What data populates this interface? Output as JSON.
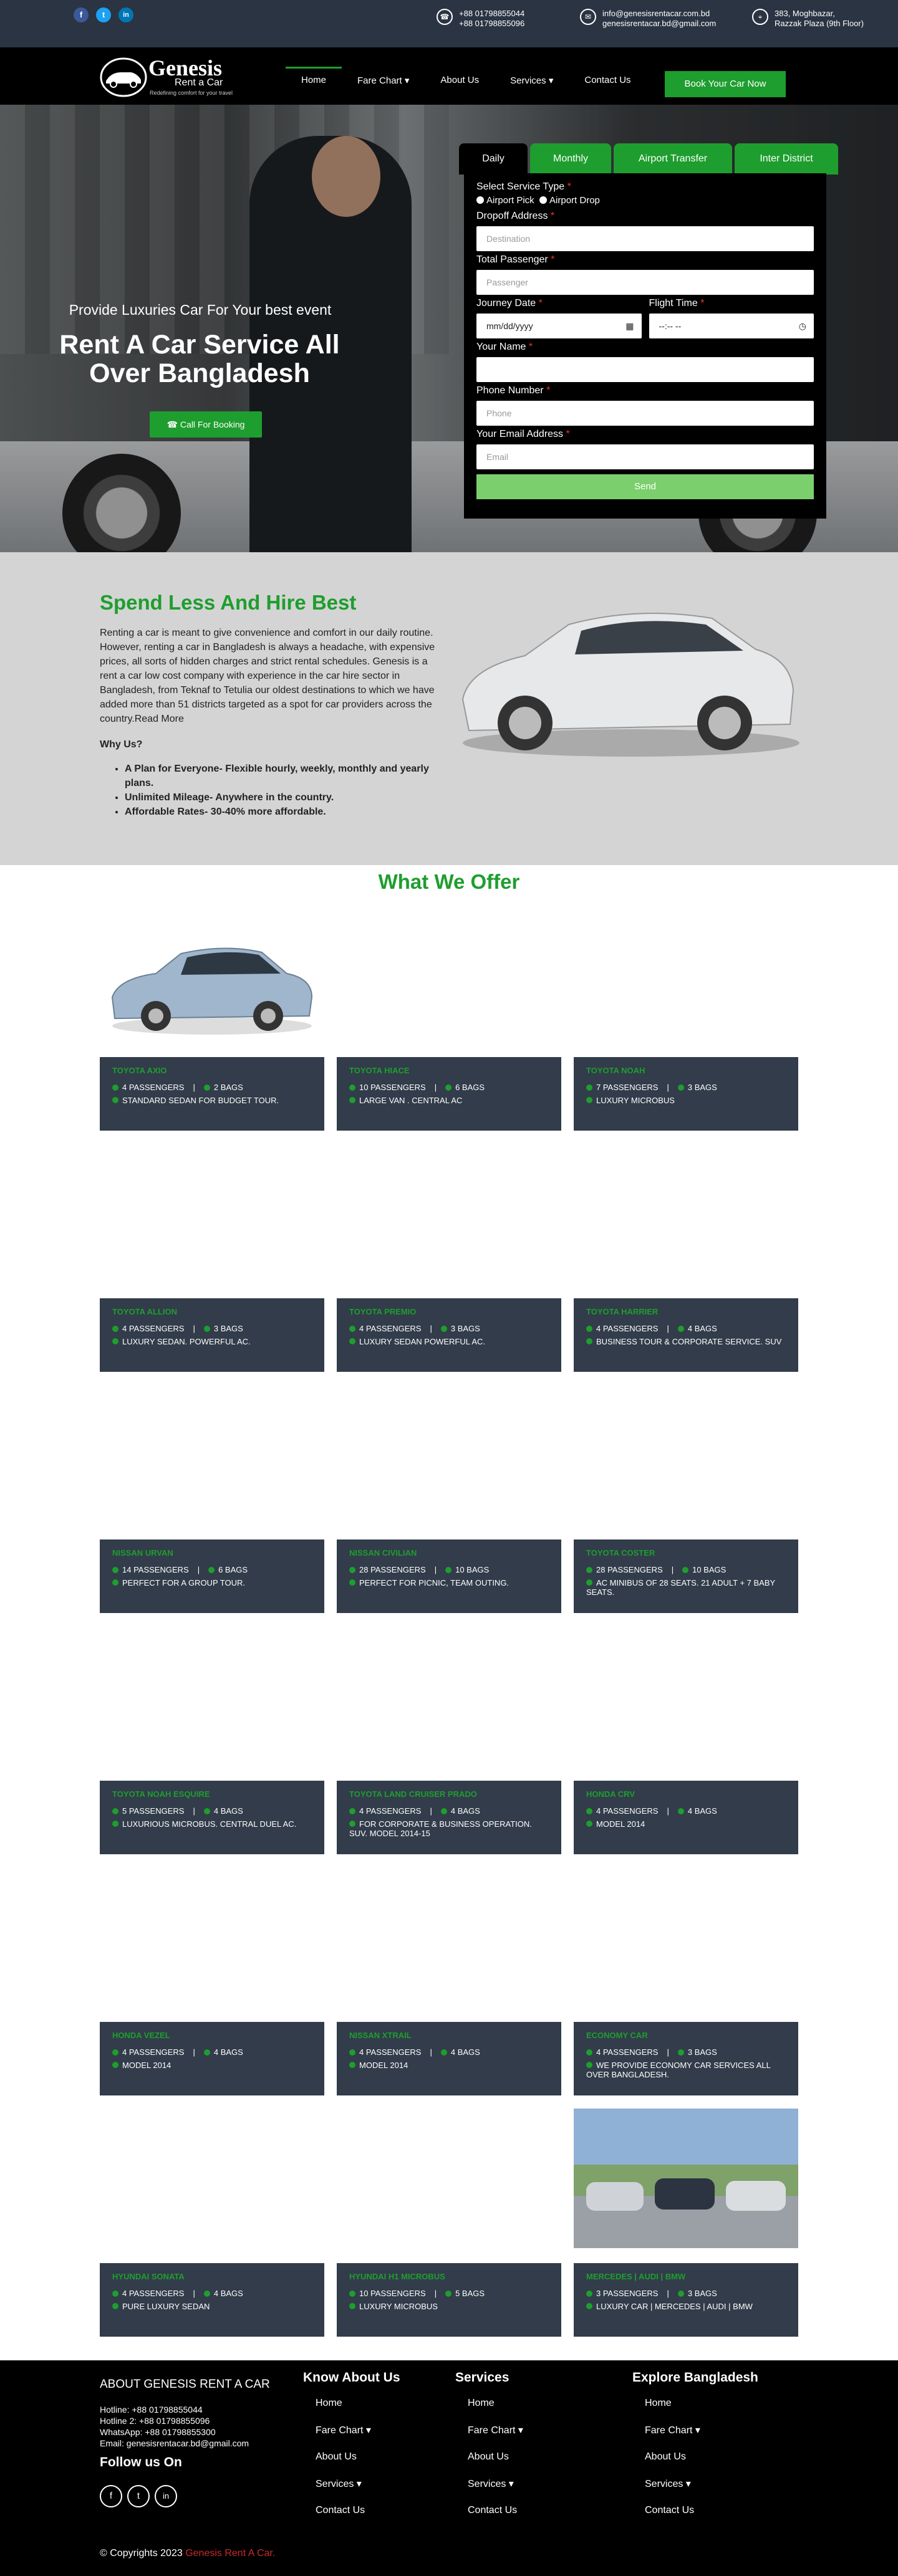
{
  "topbar": {
    "social": [
      "f",
      "t",
      "in"
    ],
    "phone1": "+88 01798855044",
    "phone2": "+88 01798855096",
    "email1": "info@genesisrentacar.com.bd",
    "email2": "genesisrentacar.bd@gmail.com",
    "address1": "383, Moghbazar,",
    "address2": "Razzak Plaza (9th Floor)"
  },
  "logo": {
    "name": "Genesis",
    "sub": "Rent a Car",
    "tagline": "Redefining comfort for your travel"
  },
  "nav": {
    "items": [
      "Home",
      "Fare Chart",
      "About Us",
      "Services",
      "Contact Us"
    ],
    "book": "Book Your Car Now"
  },
  "hero": {
    "tagline": "Provide Luxuries Car For Your best event",
    "title": "Rent A Car Service All Over Bangladesh",
    "call": "Call For Booking"
  },
  "tabs": [
    "Daily",
    "Monthly",
    "Airport Transfer",
    "Inter District"
  ],
  "form": {
    "service_type": "Select Service Type",
    "opt1": "Airport Pick",
    "opt2": "Airport Drop",
    "dropoff": "Dropoff Address",
    "dropoff_ph": "Destination",
    "passenger": "Total Passenger",
    "passenger_ph": "Passenger",
    "date": "Journey Date",
    "date_ph": "mm/dd/yyyy",
    "time": "Flight Time",
    "time_ph": "--:-- --",
    "name": "Your Name",
    "phone": "Phone Number",
    "phone_ph": "Phone",
    "email": "Your Email Address",
    "email_ph": "Email",
    "send": "Send"
  },
  "about": {
    "title": "Spend Less And Hire Best",
    "text": "Renting a car is meant to give convenience and comfort in our daily routine. However, renting a car in Bangladesh is always a headache, with expensive prices, all sorts of hidden charges and strict rental schedules. Genesis is a rent a car low cost company with experience in the car hire sector in Bangladesh, from Teknaf to Tetulia our oldest destinations to which we have added more than 51 districts targeted as a spot for car providers across the country.Read More",
    "why": "Why Us?",
    "points": [
      "A Plan for Everyone- Flexible hourly, weekly, monthly and yearly plans.",
      "Unlimited Mileage- Anywhere in the country.",
      "Affordable Rates- 30-40% more affordable."
    ]
  },
  "offer_title": "What We Offer",
  "cars": [
    {
      "name": "TOYOTA AXIO",
      "pass": "4 PASSENGERS",
      "bags": "2 BAGS",
      "desc": "STANDARD SEDAN FOR BUDGET TOUR."
    },
    {
      "name": "TOYOTA HIACE",
      "pass": "10 PASSENGERS",
      "bags": "6 BAGS",
      "desc": "LARGE VAN . CENTRAL AC"
    },
    {
      "name": "TOYOTA NOAH",
      "pass": "7 PASSENGERS",
      "bags": "3 BAGS",
      "desc": "LUXURY MICROBUS"
    },
    {
      "name": "TOYOTA ALLION",
      "pass": "4 PASSENGERS",
      "bags": "3 BAGS",
      "desc": "LUXURY SEDAN. POWERFUL AC."
    },
    {
      "name": "TOYOTA PREMIO",
      "pass": "4 PASSENGERS",
      "bags": "3 BAGS",
      "desc": "LUXURY SEDAN POWERFUL AC."
    },
    {
      "name": "TOYOTA HARRIER",
      "pass": "4 PASSENGERS",
      "bags": "4 BAGS",
      "desc": "BUSINESS TOUR & CORPORATE SERVICE. SUV"
    },
    {
      "name": "NISSAN URVAN",
      "pass": "14 PASSENGERS",
      "bags": "6 BAGS",
      "desc": "PERFECT FOR A GROUP TOUR."
    },
    {
      "name": "NISSAN CIVILIAN",
      "pass": "28 PASSENGERS",
      "bags": "10 BAGS",
      "desc": "PERFECT FOR PICNIC, TEAM OUTING."
    },
    {
      "name": "TOYOTA COSTER",
      "pass": "28 PASSENGERS",
      "bags": "10 BAGS",
      "desc": "AC MINIBUS OF 28 SEATS. 21 ADULT + 7 BABY SEATS."
    },
    {
      "name": "TOYOTA NOAH ESQUIRE",
      "pass": "5 PASSENGERS",
      "bags": "4 BAGS",
      "desc": "LUXURIOUS MICROBUS. CENTRAL DUEL AC."
    },
    {
      "name": "TOYOTA LAND CRUISER PRADO",
      "pass": "4 PASSENGERS",
      "bags": "4 BAGS",
      "desc": "FOR CORPORATE & BUSINESS OPERATION. SUV. MODEL 2014-15"
    },
    {
      "name": "HONDA CRV",
      "pass": "4 PASSENGERS",
      "bags": "4 BAGS",
      "desc": "MODEL 2014"
    },
    {
      "name": "HONDA VEZEL",
      "pass": "4 PASSENGERS",
      "bags": "4 BAGS",
      "desc": "MODEL 2014"
    },
    {
      "name": "NISSAN XTRAIL",
      "pass": "4 PASSENGERS",
      "bags": "4 BAGS",
      "desc": "MODEL 2014"
    },
    {
      "name": "ECONOMY CAR",
      "pass": "4 PASSENGERS",
      "bags": "3 BAGS",
      "desc": "WE PROVIDE ECONOMY CAR SERVICES ALL OVER BANGLADESH."
    },
    {
      "name": "HYUNDAI SONATA",
      "pass": "4 PASSENGERS",
      "bags": "4 BAGS",
      "desc": "PURE LUXURY SEDAN"
    },
    {
      "name": "HYUNDAI H1 MICROBUS",
      "pass": "10 PASSENGERS",
      "bags": "5 BAGS",
      "desc": "LUXURY MICROBUS"
    },
    {
      "name": "MERCEDES | AUDI | BMW",
      "pass": "3 PASSENGERS",
      "bags": "3 BAGS",
      "desc": "LUXURY CAR | MERCEDES | AUDI | BMW"
    }
  ],
  "footer": {
    "about_title": "ABOUT GENESIS RENT A CAR",
    "hot1": "Hotline: +88 01798855044",
    "hot2": "Hotline 2: +88 01798855096",
    "wa": "WhatsApp: +88 01798855300",
    "email": "Email: genesisrentacar.bd@gmail.com",
    "follow": "Follow us On",
    "col1": "Know About Us",
    "col2": "Services",
    "col3": "Explore Bangladesh",
    "links": [
      "Home",
      "Fare Chart",
      "About Us",
      "Services",
      "Contact Us"
    ],
    "copy": "© Copyrights 2023",
    "brand": "Genesis Rent A Car."
  }
}
